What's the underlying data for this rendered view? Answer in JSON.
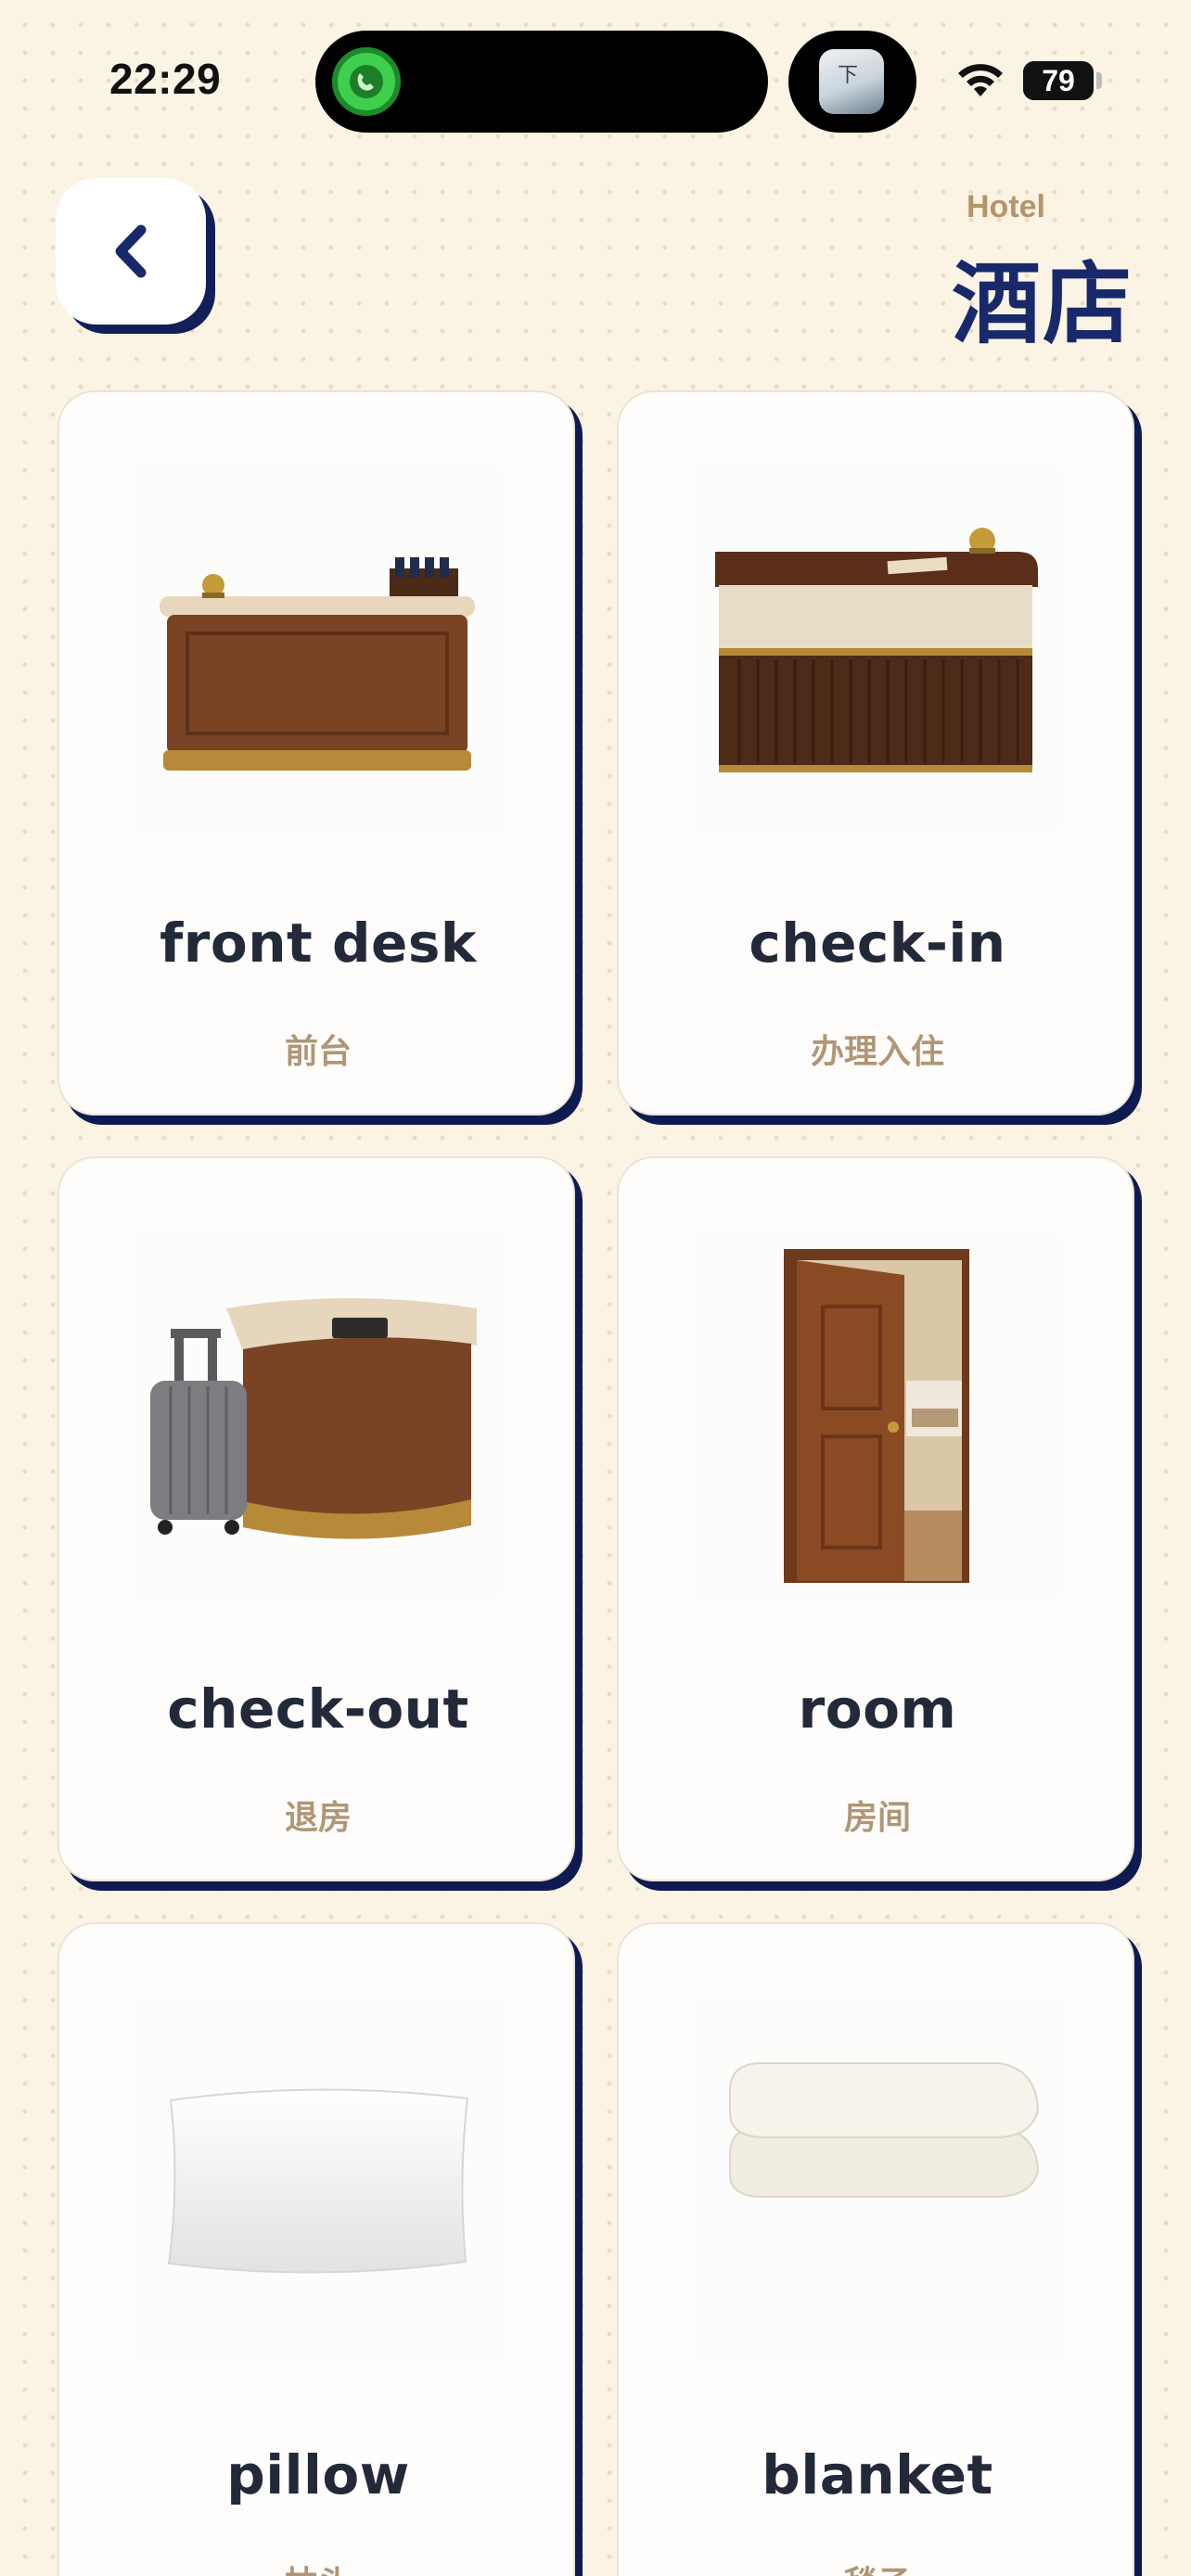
{
  "status_bar": {
    "time": "22:29",
    "battery": "79",
    "battery_level": 0.79,
    "activity_icon": "call-activity-icon",
    "wifi_icon": "wifi-icon"
  },
  "header": {
    "back_icon": "chevron-left-icon",
    "subtitle": "Hotel",
    "title": "酒店"
  },
  "colors": {
    "background": "#fbf3e4",
    "accent_navy": "#17296b",
    "word_text": "#222a3a",
    "translation_text": "#b09675",
    "subtitle_text": "#b4946a"
  },
  "cards": [
    {
      "word": "front desk",
      "translation": "前台",
      "image": "reception-desk-with-bell-image"
    },
    {
      "word": "check-in",
      "translation": "办理入住",
      "image": "check-in-counter-with-bell-image"
    },
    {
      "word": "check-out",
      "translation": "退房",
      "image": "suitcase-and-counter-image"
    },
    {
      "word": "room",
      "translation": "房间",
      "image": "open-room-door-image"
    },
    {
      "word": "pillow",
      "translation": "枕头",
      "image": "white-pillow-image"
    },
    {
      "word": "blanket",
      "translation": "毯子",
      "image": "folded-blanket-image"
    }
  ]
}
